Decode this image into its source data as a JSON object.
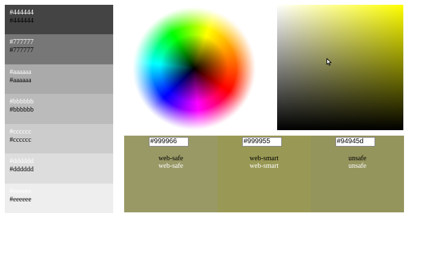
{
  "swatches": [
    {
      "bg": "#444444",
      "light_label": "#444444",
      "dark_label": "#444444"
    },
    {
      "bg": "#777777",
      "light_label": "#777777",
      "dark_label": "#777777"
    },
    {
      "bg": "#aaaaaa",
      "light_label": "#aaaaaa",
      "dark_label": "#aaaaaa"
    },
    {
      "bg": "#bbbbbb",
      "light_label": "#bbbbbb",
      "dark_label": "#bbbbbb"
    },
    {
      "bg": "#cccccc",
      "light_label": "#cccccc",
      "dark_label": "#cccccc"
    },
    {
      "bg": "#dddddd",
      "light_label": "#dddddd",
      "dark_label": "#dddddd"
    },
    {
      "bg": "#eeeeee",
      "light_label": "#eeeeee",
      "dark_label": "#eeeeee"
    }
  ],
  "picker": {
    "hue_color": "#ffff00"
  },
  "samples": [
    {
      "bg": "#999966",
      "hex": "#999966",
      "class_dark": "web-safe",
      "class_light": "web-safe"
    },
    {
      "bg": "#999955",
      "hex": "#999955",
      "class_dark": "web-smart",
      "class_light": "web-smart"
    },
    {
      "bg": "#94945d",
      "hex": "#94945d",
      "class_dark": "unsafe",
      "class_light": "unsafe"
    }
  ]
}
